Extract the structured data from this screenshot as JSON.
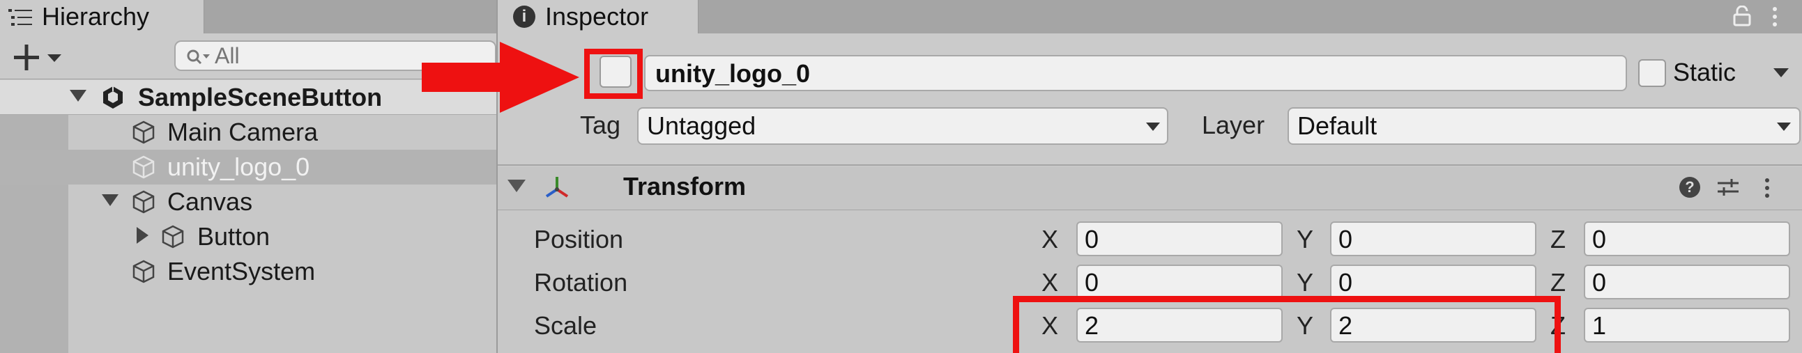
{
  "hierarchy": {
    "tab_label": "Hierarchy",
    "search": {
      "placeholder": "All",
      "value": ""
    },
    "scene": "SampleSceneButton",
    "items": [
      {
        "label": "Main Camera",
        "active": true
      },
      {
        "label": "unity_logo_0",
        "active": false,
        "selected": true
      },
      {
        "label": "Canvas",
        "active": true,
        "expanded": true
      },
      {
        "label": "Button",
        "active": true,
        "expanded": false
      },
      {
        "label": "EventSystem",
        "active": true
      }
    ]
  },
  "inspector": {
    "tab_label": "Inspector",
    "object_name": "unity_logo_0",
    "active": false,
    "static_label": "Static",
    "static": false,
    "tag_label": "Tag",
    "tag_value": "Untagged",
    "layer_label": "Layer",
    "layer_value": "Default",
    "transform": {
      "title": "Transform",
      "axes": {
        "x": "X",
        "y": "Y",
        "z": "Z"
      },
      "position": {
        "label": "Position",
        "x": "0",
        "y": "0",
        "z": "0"
      },
      "rotation": {
        "label": "Rotation",
        "x": "0",
        "y": "0",
        "z": "0"
      },
      "scale": {
        "label": "Scale",
        "x": "2",
        "y": "2",
        "z": "1"
      }
    }
  },
  "annotation_color": "#ee1111"
}
